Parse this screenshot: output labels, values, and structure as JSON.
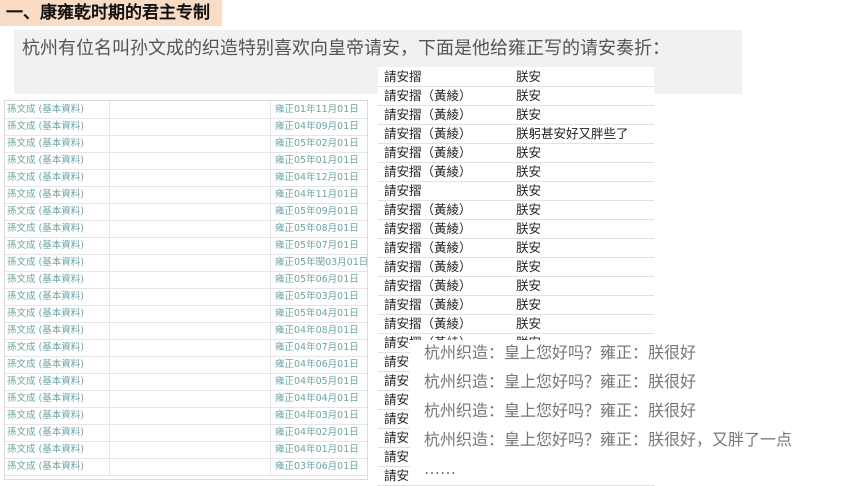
{
  "heading": "一、康雍乾时期的君主专制",
  "intro": "杭州有位名叫孙文成的织造特别喜欢向皇帝请安，下面是他给雍正写的请安奏折：",
  "left_table": {
    "rows": [
      {
        "name": "孫文成 (基本資料)",
        "date": "雍正01年11月01日"
      },
      {
        "name": "孫文成 (基本資料)",
        "date": "雍正04年09月01日"
      },
      {
        "name": "孫文成 (基本資料)",
        "date": "雍正05年02月01日"
      },
      {
        "name": "孫文成 (基本資料)",
        "date": "雍正05年01月01日"
      },
      {
        "name": "孫文成 (基本資料)",
        "date": "雍正04年12月01日"
      },
      {
        "name": "孫文成 (基本資料)",
        "date": "雍正04年11月01日"
      },
      {
        "name": "孫文成 (基本資料)",
        "date": "雍正05年09月01日"
      },
      {
        "name": "孫文成 (基本資料)",
        "date": "雍正05年08月01日"
      },
      {
        "name": "孫文成 (基本資料)",
        "date": "雍正05年07月01日"
      },
      {
        "name": "孫文成 (基本資料)",
        "date": "雍正05年閏03月01日"
      },
      {
        "name": "孫文成 (基本資料)",
        "date": "雍正05年06月01日"
      },
      {
        "name": "孫文成 (基本資料)",
        "date": "雍正05年03月01日"
      },
      {
        "name": "孫文成 (基本資料)",
        "date": "雍正05年04月01日"
      },
      {
        "name": "孫文成 (基本資料)",
        "date": "雍正04年08月01日"
      },
      {
        "name": "孫文成 (基本資料)",
        "date": "雍正04年07月01日"
      },
      {
        "name": "孫文成 (基本資料)",
        "date": "雍正04年06月01日"
      },
      {
        "name": "孫文成 (基本資料)",
        "date": "雍正04年05月01日"
      },
      {
        "name": "孫文成 (基本資料)",
        "date": "雍正04年04月01日"
      },
      {
        "name": "孫文成 (基本資料)",
        "date": "雍正04年03月01日"
      },
      {
        "name": "孫文成 (基本資料)",
        "date": "雍正04年02月01日"
      },
      {
        "name": "孫文成 (基本資料)",
        "date": "雍正04年01月01日"
      },
      {
        "name": "孫文成 (基本資料)",
        "date": "雍正03年06月01日"
      }
    ]
  },
  "right_table": {
    "rows": [
      {
        "c1": "請安摺",
        "c2": "朕安"
      },
      {
        "c1": "請安摺（黃綾）",
        "c2": "朕安"
      },
      {
        "c1": "請安摺（黃綾）",
        "c2": "朕安"
      },
      {
        "c1": "請安摺（黃綾）",
        "c2": "朕躬甚安好又胖些了"
      },
      {
        "c1": "請安摺（黃綾）",
        "c2": "朕安"
      },
      {
        "c1": "請安摺（黃綾）",
        "c2": "朕安"
      },
      {
        "c1": "請安摺",
        "c2": "朕安"
      },
      {
        "c1": "請安摺（黃綾）",
        "c2": "朕安"
      },
      {
        "c1": "請安摺（黃綾）",
        "c2": "朕安"
      },
      {
        "c1": "請安摺（黃綾）",
        "c2": "朕安"
      },
      {
        "c1": "請安摺（黃綾）",
        "c2": "朕安"
      },
      {
        "c1": "請安摺（黃綾）",
        "c2": "朕安"
      },
      {
        "c1": "請安摺（黃綾）",
        "c2": "朕安"
      },
      {
        "c1": "請安摺（黃綾）",
        "c2": "朕安"
      },
      {
        "c1": "請安摺（黃綾）",
        "c2": "朕安"
      },
      {
        "c1": "請安",
        "c2": ""
      },
      {
        "c1": "請安",
        "c2": ""
      },
      {
        "c1": "請安",
        "c2": ""
      },
      {
        "c1": "請安",
        "c2": ""
      },
      {
        "c1": "請安",
        "c2": ""
      },
      {
        "c1": "請安",
        "c2": ""
      },
      {
        "c1": "請安",
        "c2": ""
      }
    ]
  },
  "dialogue": [
    "杭州织造：皇上您好吗？雍正：朕很好",
    "杭州织造：皇上您好吗？雍正：朕很好",
    "杭州织造：皇上您好吗？雍正：朕很好",
    "杭州织造：皇上您好吗？雍正：朕很好，又胖了一点",
    "……"
  ]
}
